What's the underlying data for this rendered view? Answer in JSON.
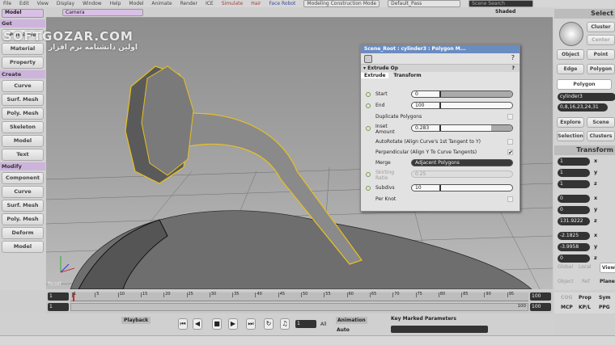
{
  "menubar": {
    "items": [
      "File",
      "Edit",
      "View",
      "Display",
      "Window",
      "Help"
    ],
    "modules": [
      "Model",
      "Animate",
      "Render",
      "ICE",
      "Simulate",
      "Hair",
      "Face Robot"
    ],
    "mode": "Modeling Construction Mode",
    "pass": "Default_Pass",
    "search_placeholder": "Scene Search"
  },
  "left": {
    "module": "Model",
    "sections": [
      {
        "title": "Get",
        "buttons": [
          "Primitive",
          "Material",
          "Property"
        ]
      },
      {
        "title": "Create",
        "buttons": [
          "Curve",
          "Surf. Mesh",
          "Poly. Mesh",
          "Skeleton",
          "Model",
          "Text"
        ]
      },
      {
        "title": "Modify",
        "buttons": [
          "Component",
          "Curve",
          "Surf. Mesh",
          "Poly. Mesh",
          "Deform",
          "Model"
        ]
      }
    ]
  },
  "viewport": {
    "camera": "Camera",
    "shading": "Shaded",
    "corner_label": "Reset"
  },
  "watermark": {
    "line1": "SOFTGOZAR.COM",
    "line2": "اولین دانشنامه نرم افزار"
  },
  "ppg": {
    "title": "Scene_Root : cylinder3 : Polygon M...",
    "section": "Extrude Op",
    "tabs": [
      "Extrude",
      "Transform"
    ],
    "start_label": "Start",
    "start": "0",
    "end_label": "End",
    "end": "100",
    "dup_label": "Duplicate Polygons",
    "inset_label": "Inset Amount",
    "inset": "0.283",
    "autorotate_label": "AutoRotate (Align Curve's 1st Tangent to Y)",
    "perp_label": "Perpendicular (Align Y To Curve Tangents)",
    "merge_label": "Merge",
    "merge": "Adjacent Polygons",
    "skirting_label": "Skirting Ratio",
    "skirting": "0.25",
    "subdivs_label": "Subdivs",
    "subdivs": "10",
    "perknot_label": "Per Knot",
    "help": "?"
  },
  "right": {
    "select_title": "Select",
    "cluster": "Cluster",
    "center": "Center",
    "object": "Object",
    "point": "Point",
    "edge": "Edge",
    "polygon": "Polygon",
    "active": "Polygon",
    "name": "cylinder3",
    "components": "0,8,16,23,24,31",
    "explore": "Explore",
    "scene": "Scene",
    "selection": "Selection",
    "clusters": "Clusters",
    "transform_title": "Transform",
    "scale": [
      "1",
      "1",
      "1"
    ],
    "rotate": [
      "0",
      "0",
      "131.9222"
    ],
    "translate": [
      "-2.1825",
      "-3.9958",
      "0"
    ],
    "axes": [
      "x",
      "y",
      "z"
    ],
    "global": "Global",
    "local": "Local",
    "view": "View",
    "objectref": "Object",
    "ref": "Ref",
    "plane": "Plane",
    "cog": "COG",
    "prop": "Prop",
    "sym": "Sym",
    "mcp": "MCP",
    "kp": "KP/L",
    "ppg": "PPG"
  },
  "timeline": {
    "start": "1",
    "end": "100",
    "current": "1",
    "range_end": "100",
    "ticks": [
      "1",
      "5",
      "10",
      "15",
      "20",
      "25",
      "30",
      "35",
      "40",
      "45",
      "50",
      "55",
      "60",
      "65",
      "70",
      "75",
      "80",
      "85",
      "90",
      "95"
    ]
  },
  "bottom": {
    "playback": "Playback",
    "frame": "1",
    "all": "All",
    "animation": "Animation",
    "auto": "Auto",
    "key_marked": "Key Marked Parameters"
  }
}
